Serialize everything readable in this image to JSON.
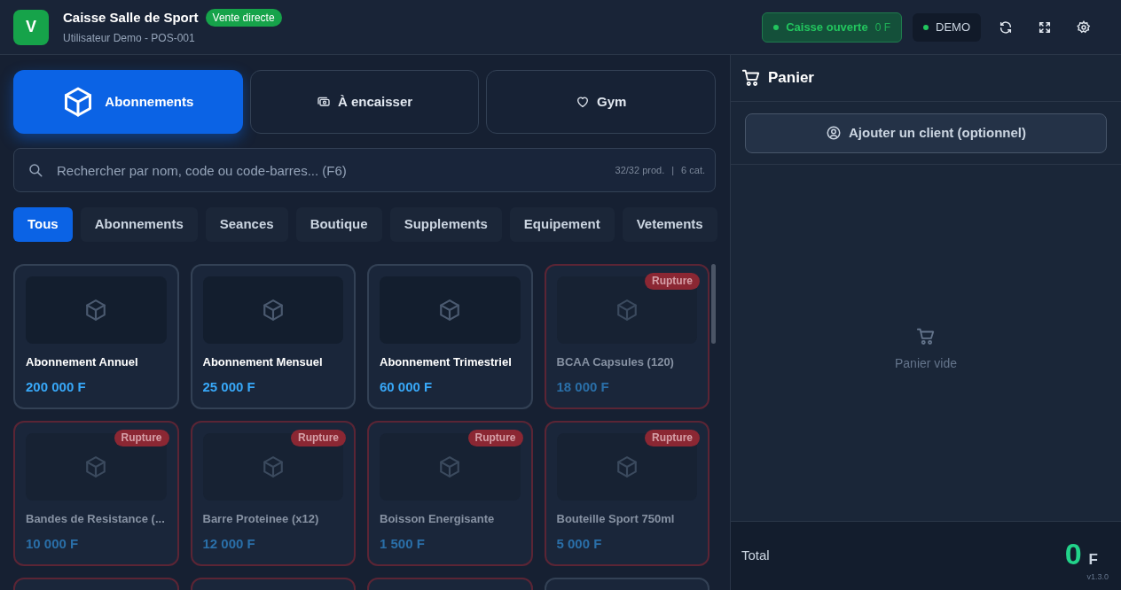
{
  "header": {
    "logo_letter": "V",
    "title": "Caisse Salle de Sport",
    "mode_badge": "Vente directe",
    "subtitle": "Utilisateur Demo - POS-001",
    "register": {
      "label": "Caisse ouverte",
      "amount": "0 F",
      "open": true
    },
    "env": {
      "label": "DEMO"
    }
  },
  "modes": [
    {
      "label": "Abonnements",
      "selected": true
    },
    {
      "label": "À encaisser",
      "selected": false
    },
    {
      "label": "Gym",
      "selected": false
    }
  ],
  "search": {
    "placeholder": "Rechercher par nom, code ou code-barres... (F6)",
    "product_count": "32/32 prod.",
    "separator": "|",
    "category_count": "6 cat."
  },
  "categories": [
    {
      "label": "Tous",
      "selected": true
    },
    {
      "label": "Abonnements",
      "selected": false
    },
    {
      "label": "Seances",
      "selected": false
    },
    {
      "label": "Boutique",
      "selected": false
    },
    {
      "label": "Supplements",
      "selected": false
    },
    {
      "label": "Equipement",
      "selected": false
    },
    {
      "label": "Vetements",
      "selected": false
    }
  ],
  "products": [
    {
      "name": "Abonnement Annuel",
      "price": "200 000 F",
      "out_of_stock": false
    },
    {
      "name": "Abonnement Mensuel",
      "price": "25 000 F",
      "out_of_stock": false
    },
    {
      "name": "Abonnement Trimestriel",
      "price": "60 000 F",
      "out_of_stock": false
    },
    {
      "name": "BCAA Capsules (120)",
      "price": "18 000 F",
      "out_of_stock": true,
      "badge": "Rupture"
    },
    {
      "name": "Bandes de Resistance (...",
      "price": "10 000 F",
      "out_of_stock": true,
      "badge": "Rupture"
    },
    {
      "name": "Barre Proteinee (x12)",
      "price": "12 000 F",
      "out_of_stock": true,
      "badge": "Rupture"
    },
    {
      "name": "Boisson Energisante",
      "price": "1 500 F",
      "out_of_stock": true,
      "badge": "Rupture"
    },
    {
      "name": "Bouteille Sport 750ml",
      "price": "5 000 F",
      "out_of_stock": true,
      "badge": "Rupture"
    },
    {
      "out_of_stock": true
    },
    {
      "out_of_stock": true
    },
    {
      "out_of_stock": true
    },
    {
      "out_of_stock": false
    }
  ],
  "cart": {
    "title": "Panier",
    "add_client": "Ajouter un client (optionnel)",
    "empty_text": "Panier vide",
    "total_label": "Total",
    "total_amount": "0",
    "currency": "F",
    "version": "v1.3.0"
  }
}
